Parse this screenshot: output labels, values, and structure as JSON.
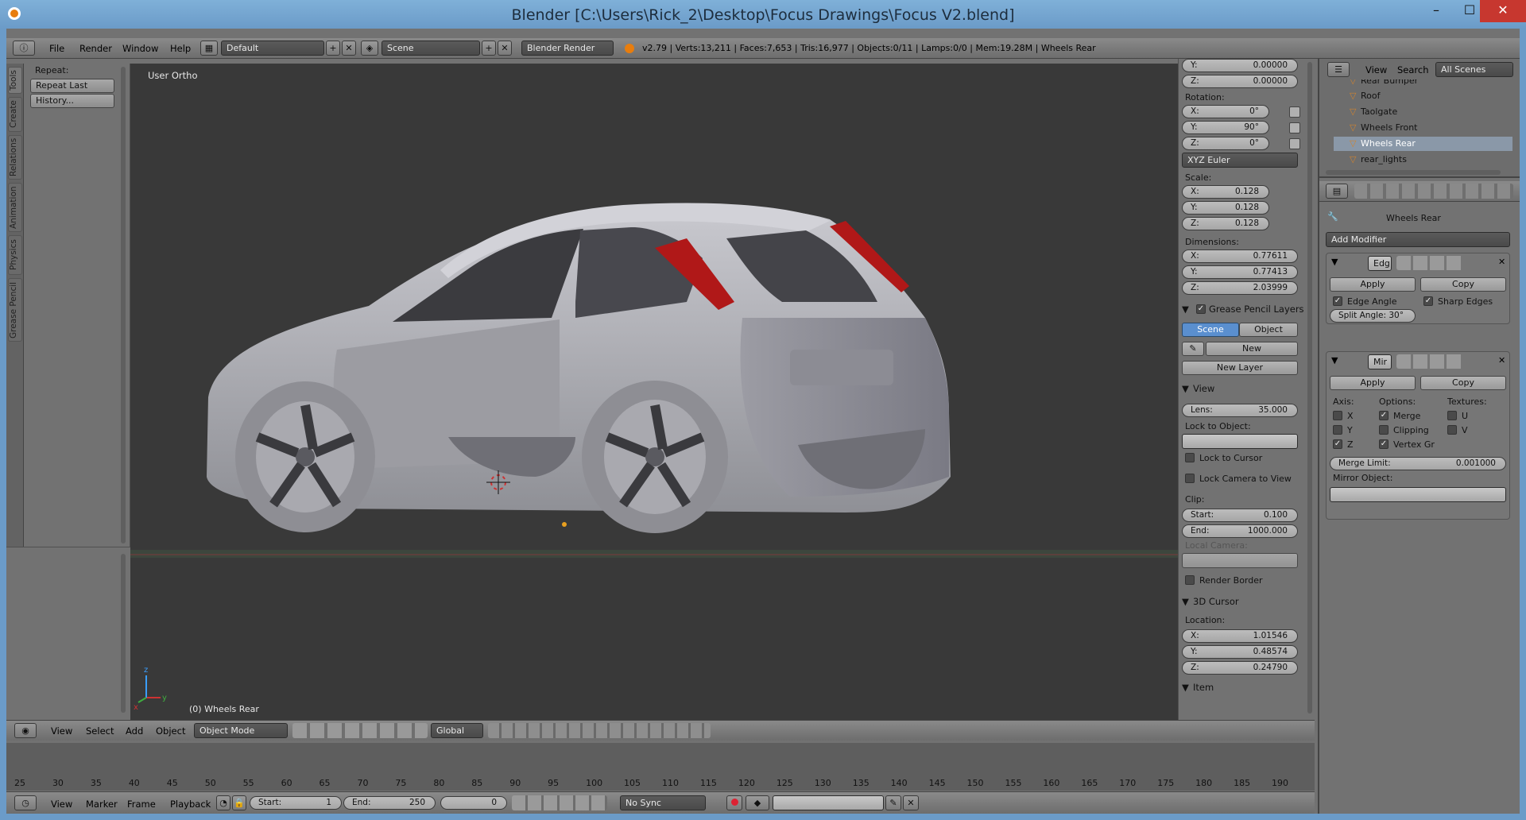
{
  "window": {
    "title": "Blender [C:\\Users\\Rick_2\\Desktop\\Focus Drawings\\Focus V2.blend]",
    "min": "–",
    "max": "☐",
    "close": "✕"
  },
  "info_header": {
    "menus": [
      "File",
      "Render",
      "Window",
      "Help"
    ],
    "screen_layout": "Default",
    "scene": "Scene",
    "engine": "Blender Render",
    "stats": "v2.79 | Verts:13,211 | Faces:7,653 | Tris:16,977 | Objects:0/11 | Lamps:0/0 | Mem:19.28M | Wheels Rear"
  },
  "tool_tabs": [
    "Tools",
    "Create",
    "Relations",
    "Animation",
    "Physics",
    "Grease Pencil"
  ],
  "tool_shelf": {
    "heading": "Repeat:",
    "buttons": [
      "Repeat Last",
      "History..."
    ]
  },
  "viewport": {
    "view_label": "User Ortho",
    "object_label": "(0) Wheels Rear",
    "axis_x": "x",
    "axis_y": "y",
    "axis_z": "z"
  },
  "npanel": {
    "location_y": {
      "k": "Y:",
      "v": "0.00000"
    },
    "location_z": {
      "k": "Z:",
      "v": "0.00000"
    },
    "rotation_label": "Rotation:",
    "rotation": [
      {
        "k": "X:",
        "v": "0°"
      },
      {
        "k": "Y:",
        "v": "90°"
      },
      {
        "k": "Z:",
        "v": "0°"
      }
    ],
    "rotation_mode": "XYZ Euler",
    "scale_label": "Scale:",
    "scale": [
      {
        "k": "X:",
        "v": "0.128"
      },
      {
        "k": "Y:",
        "v": "0.128"
      },
      {
        "k": "Z:",
        "v": "0.128"
      }
    ],
    "dimensions_label": "Dimensions:",
    "dimensions": [
      {
        "k": "X:",
        "v": "0.77611"
      },
      {
        "k": "Y:",
        "v": "0.77413"
      },
      {
        "k": "Z:",
        "v": "2.03999"
      }
    ],
    "grease_pencil_label": "Grease Pencil Layers",
    "gp_scene": "Scene",
    "gp_object": "Object",
    "gp_new": "New",
    "gp_new_layer": "New Layer",
    "view_label": "View",
    "lens": {
      "k": "Lens:",
      "v": "35.000"
    },
    "lock_to_object": "Lock to Object:",
    "lock_to_cursor": "Lock to Cursor",
    "lock_camera": "Lock Camera to View",
    "clip_label": "Clip:",
    "clip_start": {
      "k": "Start:",
      "v": "0.100"
    },
    "clip_end": {
      "k": "End:",
      "v": "1000.000"
    },
    "local_camera": "Local Camera:",
    "render_border": "Render Border",
    "cursor_label": "3D Cursor",
    "cursor_location": "Location:",
    "cursor": [
      {
        "k": "X:",
        "v": "1.01546"
      },
      {
        "k": "Y:",
        "v": "0.48574"
      },
      {
        "k": "Z:",
        "v": "0.24790"
      }
    ],
    "item_label": "Item"
  },
  "outliner": {
    "menus": [
      "View",
      "Search"
    ],
    "filter": "All Scenes",
    "rows": [
      "Rear Bumper",
      "Roof",
      "Taolgate",
      "Wheels Front",
      "Wheels Rear",
      "rear_lights"
    ]
  },
  "properties": {
    "breadcrumb": "Wheels Rear",
    "add_modifier": "Add Modifier",
    "edge_split": {
      "name": "Edg",
      "apply": "Apply",
      "copy": "Copy",
      "edge_angle": "Edge Angle",
      "sharp_edges": "Sharp Edges",
      "split_angle": "Split Angle: 30°"
    },
    "mirror": {
      "name": "Mir",
      "apply": "Apply",
      "copy": "Copy",
      "axis": "Axis:",
      "options": "Options:",
      "textures": "Textures:",
      "x": "X",
      "y": "Y",
      "z": "Z",
      "merge": "Merge",
      "clipping": "Clipping",
      "vertex": "Vertex Gr",
      "u": "U",
      "v": "V",
      "merge_limit": {
        "k": "Merge Limit:",
        "v": "0.001000"
      },
      "mirror_object": "Mirror Object:"
    }
  },
  "viewport_header": {
    "menus": [
      "View",
      "Select",
      "Add",
      "Object"
    ],
    "mode": "Object Mode",
    "orientation": "Global"
  },
  "timeline": {
    "ticks": [
      "25",
      "30",
      "35",
      "40",
      "45",
      "50",
      "55",
      "60",
      "65",
      "70",
      "75",
      "80",
      "85",
      "90",
      "95",
      "100",
      "105",
      "110",
      "115",
      "120",
      "125",
      "130",
      "135",
      "140",
      "145",
      "150",
      "155",
      "160",
      "165",
      "170",
      "175",
      "180",
      "185",
      "190"
    ],
    "menus": [
      "View",
      "Marker",
      "Frame",
      "Playback"
    ],
    "start": {
      "k": "Start:",
      "v": "1"
    },
    "end": {
      "k": "End:",
      "v": "250"
    },
    "current": "0",
    "sync": "No Sync"
  },
  "colors": {
    "accent": "#5a8fcf",
    "taillight": "#b01818",
    "body": "#b9b9bf",
    "viewport_bg": "#393939"
  }
}
